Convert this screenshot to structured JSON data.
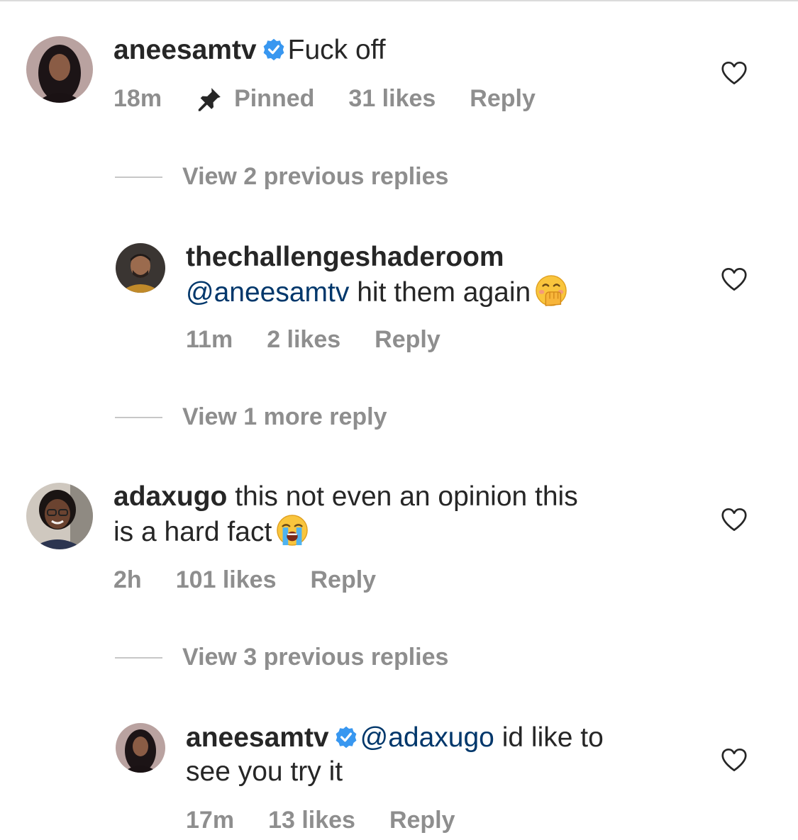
{
  "comments": [
    {
      "username": "aneesamtv",
      "verified": true,
      "text": "Fuck off",
      "time": "18m",
      "pinned_label": "Pinned",
      "likes": "31 likes",
      "reply_label": "Reply"
    },
    {
      "username": "thechallengeshaderoom",
      "mention": "@aneesamtv",
      "text": "hit them again",
      "emoji": "hand-over-mouth-emoji",
      "time": "11m",
      "likes": "2 likes",
      "reply_label": "Reply"
    },
    {
      "username": "adaxugo",
      "text_line1": "this not even an opinion this",
      "text_line2": "is a hard fact",
      "emoji": "loudly-crying-emoji",
      "time": "2h",
      "likes": "101 likes",
      "reply_label": "Reply"
    },
    {
      "username": "aneesamtv",
      "verified": true,
      "mention": "@adaxugo",
      "text_line1": "id like to",
      "text_line2": "see you try it",
      "time": "17m",
      "likes": "13 likes",
      "reply_label": "Reply"
    }
  ],
  "view_replies": [
    "View 2 previous replies",
    "View 1 more reply",
    "View 3 previous replies"
  ],
  "colors": {
    "text": "#262626",
    "secondary": "#8e8e8e",
    "mention": "#00376b",
    "verified": "#3897f0"
  }
}
